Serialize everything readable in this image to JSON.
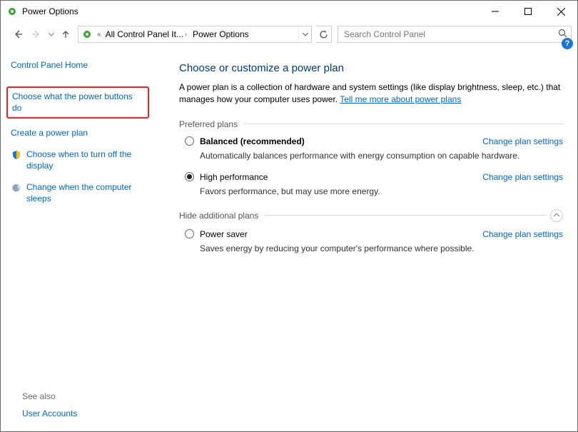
{
  "window": {
    "title": "Power Options"
  },
  "breadcrumb": {
    "seg1": "All Control Panel It...",
    "seg2": "Power Options"
  },
  "search": {
    "placeholder": "Search Control Panel"
  },
  "sidebar": {
    "home": "Control Panel Home",
    "links": [
      "Choose what the power buttons do",
      "Create a power plan",
      "Choose when to turn off the display",
      "Change when the computer sleeps"
    ],
    "see_also": "See also",
    "user_accounts": "User Accounts"
  },
  "main": {
    "title": "Choose or customize a power plan",
    "desc_a": "A power plan is a collection of hardware and system settings (like display brightness, sleep, etc.) that manages how your computer uses power. ",
    "desc_link": "Tell me more about power plans",
    "preferred_label": "Preferred plans",
    "hide_label": "Hide additional plans",
    "change_link": "Change plan settings",
    "plans_preferred": [
      {
        "name": "Balanced (recommended)",
        "desc": "Automatically balances performance with energy consumption on capable hardware.",
        "bold": true,
        "selected": false
      },
      {
        "name": "High performance",
        "desc": "Favors performance, but may use more energy.",
        "bold": false,
        "selected": true
      }
    ],
    "plans_additional": [
      {
        "name": "Power saver",
        "desc": "Saves energy by reducing your computer's performance where possible.",
        "bold": false,
        "selected": false
      }
    ]
  }
}
